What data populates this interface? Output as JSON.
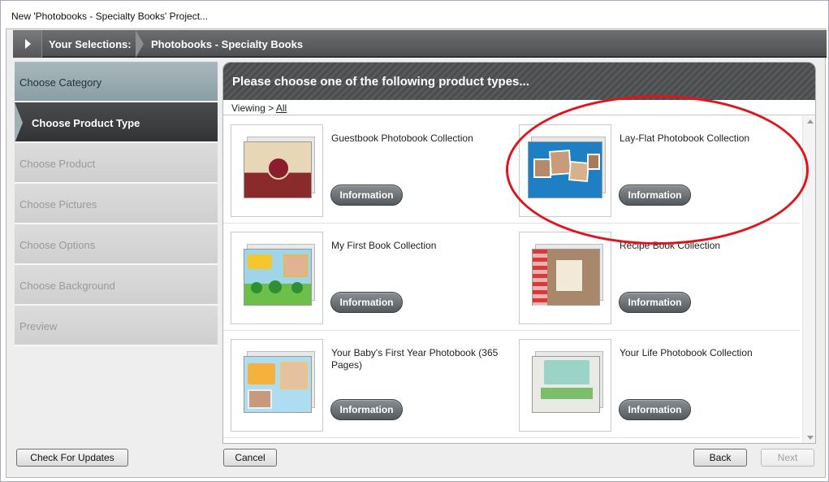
{
  "window": {
    "title": "New 'Photobooks - Specialty Books' Project..."
  },
  "selections": {
    "label": "Your Selections:",
    "value": "Photobooks - Specialty Books"
  },
  "steps": [
    {
      "label": "Choose Category",
      "state": "done"
    },
    {
      "label": "Choose Product Type",
      "state": "active"
    },
    {
      "label": "Choose Product",
      "state": "disabled"
    },
    {
      "label": "Choose Pictures",
      "state": "disabled"
    },
    {
      "label": "Choose Options",
      "state": "disabled"
    },
    {
      "label": "Choose Background",
      "state": "disabled"
    },
    {
      "label": "Preview",
      "state": "disabled"
    }
  ],
  "panel": {
    "heading": "Please choose one of the following product types...",
    "viewing_label": "Viewing >",
    "viewing_link": "All"
  },
  "products": [
    {
      "title": "Guestbook Photobook Collection",
      "button": "Information"
    },
    {
      "title": "Lay-Flat Photobook Collection",
      "button": "Information"
    },
    {
      "title": "My First Book Collection",
      "button": "Information"
    },
    {
      "title": "Recipe Book Collection",
      "button": "Information"
    },
    {
      "title": "Your Baby's First Year Photobook (365 Pages)",
      "button": "Information"
    },
    {
      "title": "Your Life Photobook Collection",
      "button": "Information"
    }
  ],
  "buttons": {
    "check_updates": "Check For Updates",
    "cancel": "Cancel",
    "back": "Back",
    "next": "Next"
  },
  "colors": {
    "annotation": "#e0141c",
    "info_button": "#5c6266",
    "active_step": "#3a3b3d"
  }
}
